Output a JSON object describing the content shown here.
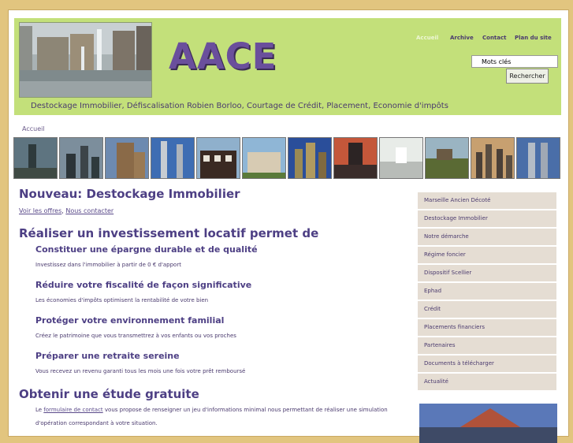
{
  "header": {
    "site_title": "AACE",
    "tagline": "Destockage Immobilier, Défiscalisation Robien Borloo, Courtage de Crédit, Placement, Economie d'impôts",
    "nav": [
      "Accueil",
      "Archive",
      "Contact",
      "Plan du site"
    ],
    "search": {
      "value": "Mots clés",
      "button_label": "Rechercher"
    }
  },
  "breadcrumb": "Accueil",
  "main": {
    "heading1": "Nouveau: Destockage Immobilier",
    "offer_links": {
      "offers": "Voir les offres",
      "separator": ", ",
      "contact": "Nous contacter"
    },
    "heading2": "Réaliser un investissement locatif permet de",
    "benefits": [
      {
        "title": "Constituer une épargne durable et de qualité",
        "text": "Investissez dans l'immobilier à partir de 0 € d'apport"
      },
      {
        "title": "Réduire votre fiscalité de façon significative",
        "text": "Les économies d'impôts optimisent la rentabilité de votre bien"
      },
      {
        "title": "Protéger votre environnement familial",
        "text": "Créez le patrimoine que vous transmettrez à vos enfants ou vos proches"
      },
      {
        "title": "Préparer une retraite sereine",
        "text": "Vous recevez un revenu garanti tous les mois une fois votre prêt remboursé"
      }
    ],
    "heading3": "Obtenir une étude gratuite",
    "study": {
      "prefix": "Le ",
      "link": "formulaire de contact",
      "suffix": " vous propose de renseigner un jeu d'informations minimal nous permettant de réaliser une simulation",
      "line2": "d'opération correspondant à votre situation."
    }
  },
  "sidebar": {
    "items": [
      "Marseille Ancien Décoté",
      "Destockage Immobilier",
      "Notre démarche",
      "Régime foncier",
      "Dispositif Scellier",
      "Ephad",
      "Crédit",
      "Placements financiers",
      "Partenaires",
      "Documents à télécharger",
      "Actualité"
    ]
  },
  "colors": {
    "page_bg": "#e2c57f",
    "header_bg": "#c3e07a",
    "title": "#6a4f9c",
    "heading": "#4d3f84",
    "sidebar_bg": "#e5ddd3"
  }
}
